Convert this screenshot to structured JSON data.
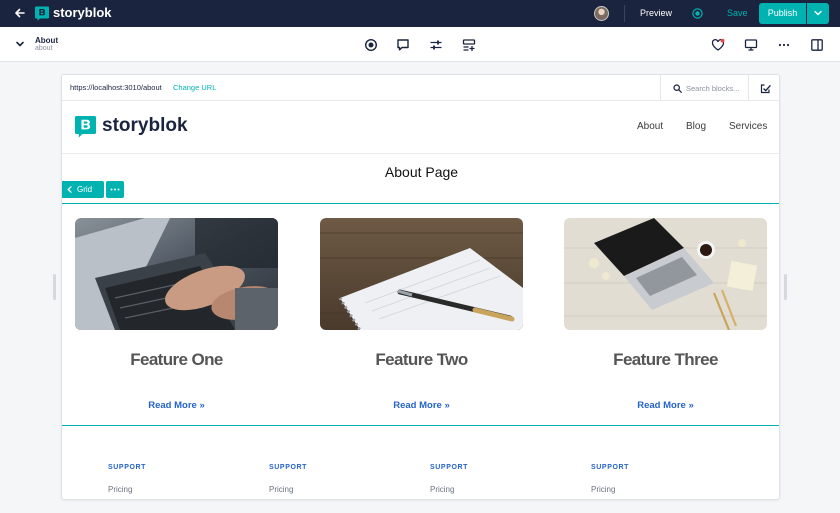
{
  "topbar": {
    "brand": "storyblok",
    "preview_label": "Preview",
    "save_label": "Save",
    "publish_label": "Publish",
    "bg_color": "#1b243f",
    "accent_color": "#00b3b0"
  },
  "story": {
    "title": "About",
    "slug": "about"
  },
  "toolbar_icons": [
    "target-icon",
    "comment-icon",
    "settings-sliders-icon",
    "add-block-icon",
    "heart-icon",
    "monitor-icon",
    "more-icon",
    "sidebar-toggle-icon"
  ],
  "preview": {
    "url": "https://localhost:3010/about",
    "change_url_label": "Change URL",
    "search_placeholder": "Search blocks..."
  },
  "site": {
    "brand": "storyblok",
    "nav": [
      "About",
      "Blog",
      "Services"
    ],
    "page_heading": "About Page",
    "grid_label": "Grid",
    "features": [
      {
        "title": "Feature One",
        "link": "Read More »",
        "image": "laptop-typing-photo"
      },
      {
        "title": "Feature Two",
        "link": "Read More »",
        "image": "notebook-pen-photo"
      },
      {
        "title": "Feature Three",
        "link": "Read More »",
        "image": "desk-laptop-photo"
      }
    ],
    "footer": [
      {
        "heading": "SUPPORT",
        "item": "Pricing"
      },
      {
        "heading": "SUPPORT",
        "item": "Pricing"
      },
      {
        "heading": "SUPPORT",
        "item": "Pricing"
      },
      {
        "heading": "SUPPORT",
        "item": "Pricing"
      }
    ]
  }
}
